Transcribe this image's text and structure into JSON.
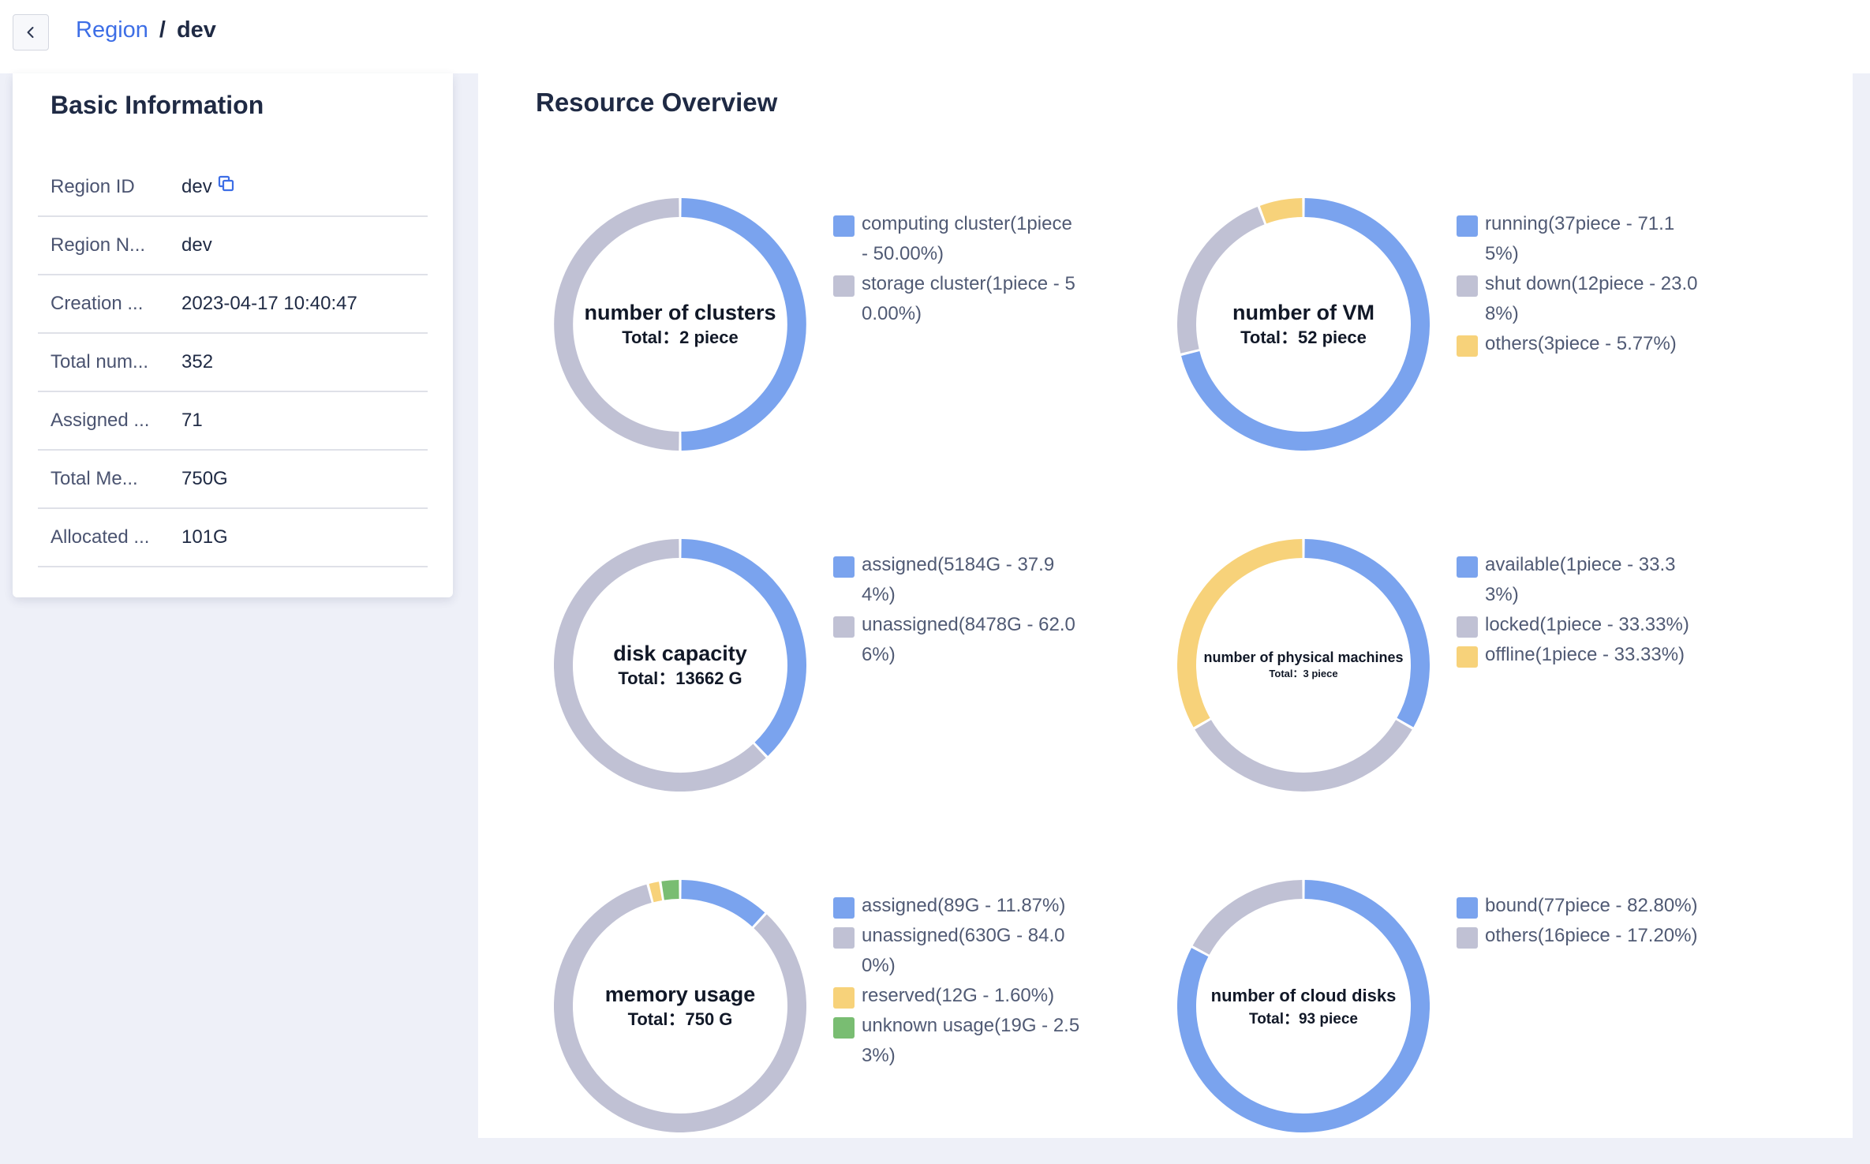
{
  "breadcrumb": {
    "parent": "Region",
    "separator": "/",
    "current": "dev"
  },
  "colors": {
    "blue": "#7aa3ee",
    "gray": "#c0c1d4",
    "yellow": "#f7d27a",
    "green": "#79bd72",
    "link": "#3d6ee6"
  },
  "info": {
    "title": "Basic Information",
    "rows": [
      {
        "label": "Region ID",
        "value": "dev",
        "copy": true
      },
      {
        "label": "Region N...",
        "value": "dev"
      },
      {
        "label": "Creation ...",
        "value": "2023-04-17 10:40:47"
      },
      {
        "label": "Total num...",
        "value": "352"
      },
      {
        "label": "Assigned ...",
        "value": "71"
      },
      {
        "label": "Total Me...",
        "value": "750G"
      },
      {
        "label": "Allocated ...",
        "value": "101G"
      }
    ]
  },
  "overview": {
    "title": "Resource Overview"
  },
  "chart_data": [
    {
      "type": "pie",
      "title": "number of clusters",
      "total_text": "Total：2 piece",
      "slices": [
        {
          "label": "computing cluster(1piece - 50.00%)",
          "value": 50.0,
          "color": "#7aa3ee"
        },
        {
          "label": "storage cluster(1piece - 50.00%)",
          "value": 50.0,
          "color": "#c0c1d4"
        }
      ],
      "legend_lines": [
        [
          "computing cluster(1piece",
          "- 50.00%)"
        ],
        [
          "storage cluster(1piece - 5",
          "0.00%)"
        ]
      ]
    },
    {
      "type": "pie",
      "title": "number of VM",
      "total_text": "Total：52 piece",
      "slices": [
        {
          "label": "running(37piece - 71.15%)",
          "value": 71.15,
          "color": "#7aa3ee"
        },
        {
          "label": "shut down(12piece - 23.08%)",
          "value": 23.08,
          "color": "#c0c1d4"
        },
        {
          "label": "others(3piece - 5.77%)",
          "value": 5.77,
          "color": "#f7d27a"
        }
      ],
      "legend_lines": [
        [
          "running(37piece - 71.1",
          "5%)"
        ],
        [
          "shut down(12piece - 23.0",
          "8%)"
        ],
        [
          "others(3piece - 5.77%)"
        ]
      ]
    },
    {
      "type": "pie",
      "title": "disk capacity",
      "total_text": "Total：13662 G",
      "slices": [
        {
          "label": "assigned(5184G - 37.94%)",
          "value": 37.94,
          "color": "#7aa3ee"
        },
        {
          "label": "unassigned(8478G - 62.06%)",
          "value": 62.06,
          "color": "#c0c1d4"
        }
      ],
      "legend_lines": [
        [
          "assigned(5184G - 37.9",
          "4%)"
        ],
        [
          "unassigned(8478G - 62.0",
          "6%)"
        ]
      ]
    },
    {
      "type": "pie",
      "title": "number of physical machines",
      "total_text": "Total：3 piece",
      "small": true,
      "slices": [
        {
          "label": "available(1piece - 33.33%)",
          "value": 33.33,
          "color": "#7aa3ee"
        },
        {
          "label": "locked(1piece - 33.33%)",
          "value": 33.33,
          "color": "#c0c1d4"
        },
        {
          "label": "offline(1piece - 33.33%)",
          "value": 33.33,
          "color": "#f7d27a"
        }
      ],
      "legend_lines": [
        [
          "available(1piece - 33.3",
          "3%)"
        ],
        [
          "locked(1piece - 33.33%)"
        ],
        [
          "offline(1piece - 33.33%)"
        ]
      ]
    },
    {
      "type": "pie",
      "title": "memory usage",
      "total_text": "Total：750 G",
      "slices": [
        {
          "label": "assigned(89G - 11.87%)",
          "value": 11.87,
          "color": "#7aa3ee"
        },
        {
          "label": "unassigned(630G - 84.00%)",
          "value": 84.0,
          "color": "#c0c1d4"
        },
        {
          "label": "reserved(12G - 1.60%)",
          "value": 1.6,
          "color": "#f7d27a"
        },
        {
          "label": "unknown usage(19G - 2.53%)",
          "value": 2.53,
          "color": "#79bd72"
        }
      ],
      "legend_lines": [
        [
          "assigned(89G - 11.87%)"
        ],
        [
          "unassigned(630G - 84.0",
          "0%)"
        ],
        [
          "reserved(12G - 1.60%)"
        ],
        [
          "unknown usage(19G - 2.5",
          "3%)"
        ]
      ]
    },
    {
      "type": "pie",
      "title": "number of cloud disks",
      "total_text": "Total：93 piece",
      "medium": true,
      "slices": [
        {
          "label": "bound(77piece - 82.80%)",
          "value": 82.8,
          "color": "#7aa3ee"
        },
        {
          "label": "others(16piece - 17.20%)",
          "value": 17.2,
          "color": "#c0c1d4"
        }
      ],
      "legend_lines": [
        [
          "bound(77piece - 82.80%)"
        ],
        [
          "others(16piece - 17.20%)"
        ]
      ]
    }
  ]
}
